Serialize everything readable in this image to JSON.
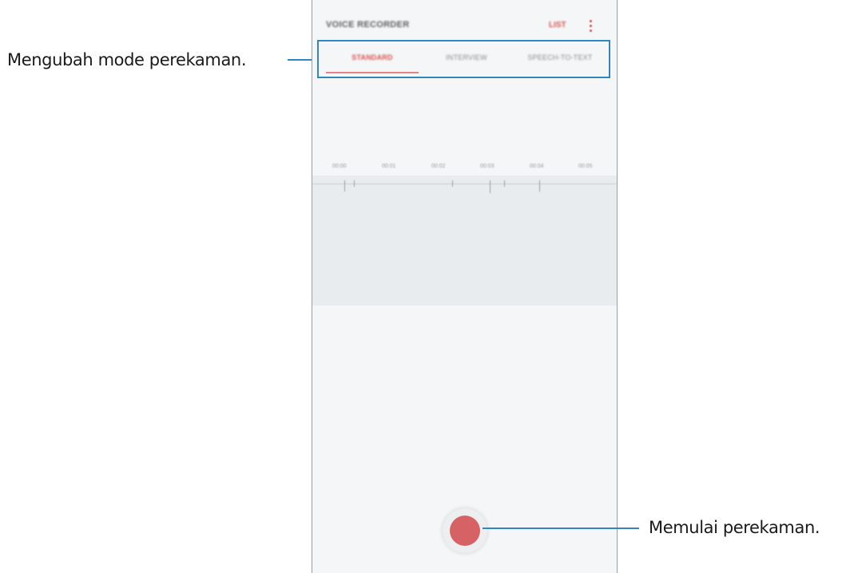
{
  "app": {
    "title": "VOICE RECORDER",
    "list_label": "LIST",
    "more_icon": "more-vertical-icon",
    "accent_color": "#d6534e"
  },
  "tabs": [
    {
      "label": "STANDARD",
      "active": true
    },
    {
      "label": "INTERVIEW",
      "active": false
    },
    {
      "label": "SPEECH-TO-TEXT",
      "active": false
    }
  ],
  "timeline": {
    "labels": [
      "00:00",
      "00:01",
      "00:02",
      "00:03",
      "00:04",
      "00:05"
    ]
  },
  "record_button": {
    "icon": "record-icon",
    "color": "#d76266"
  },
  "annotations": {
    "mode": "Mengubah mode perekaman.",
    "record": "Memulai perekaman.",
    "line_color": "#3186bf"
  }
}
